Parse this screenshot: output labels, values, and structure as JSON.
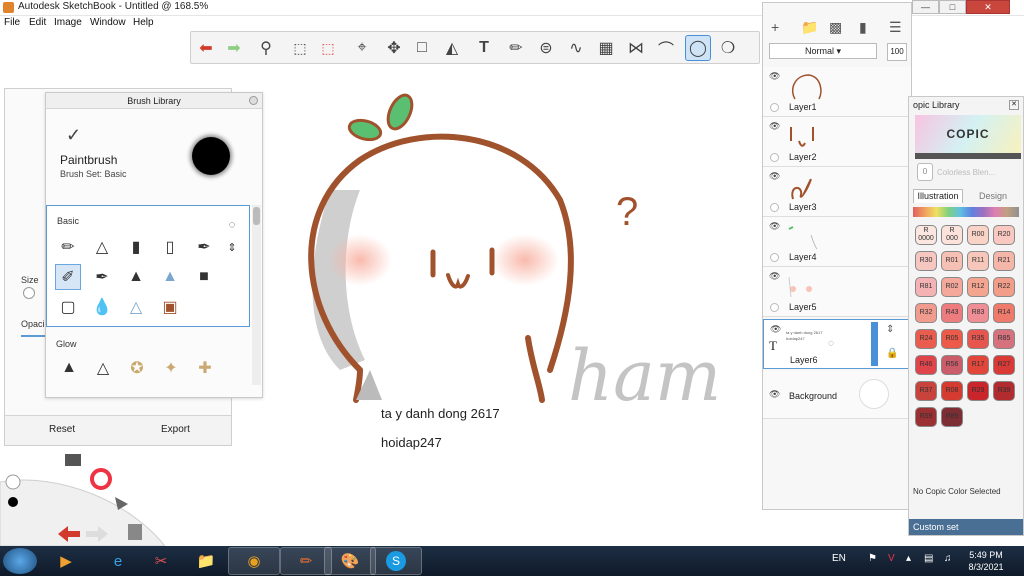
{
  "window": {
    "title": "Autodesk SketchBook - Untitled @ 168.5%"
  },
  "menu": {
    "items": [
      "File",
      "Edit",
      "Image",
      "Window",
      "Help"
    ]
  },
  "toolbar": {
    "tools": [
      "undo-icon",
      "redo-icon",
      "zoom-icon",
      "select-icon",
      "crop-icon",
      "move-icon",
      "distort-icon",
      "fill-icon",
      "text-icon",
      "ruler-icon",
      "ellipse-icon",
      "french-curve-icon",
      "perspective-icon",
      "symmetry-icon",
      "curve-icon",
      "circle-icon",
      "shape-icon"
    ],
    "active": "circle-icon"
  },
  "brush_properties": {
    "size_label": "Size",
    "opacity_label": "Opaci",
    "reset_label": "Reset",
    "export_label": "Export"
  },
  "brush_library": {
    "title": "Brush Library",
    "current_brush": "Paintbrush",
    "current_set": "Brush Set: Basic",
    "section_basic": "Basic",
    "section_glow": "Glow",
    "selected_brush": "paintbrush"
  },
  "canvas": {
    "caption1": "ta y danh dong 2617",
    "caption2": "hoidap247",
    "question_mark": "?",
    "handwriting": "ham"
  },
  "layers": {
    "blend_mode": "Normal",
    "opacity": "100",
    "items": [
      {
        "name": "Layer1"
      },
      {
        "name": "Layer2"
      },
      {
        "name": "Layer3"
      },
      {
        "name": "Layer4"
      },
      {
        "name": "Layer5"
      },
      {
        "name": "Layer6"
      },
      {
        "name": "Background"
      }
    ],
    "active_index": 5,
    "text_layer_preview": "ta y danh dong 2617 hoidap247"
  },
  "copic": {
    "title": "opic Library",
    "logo": "COPIC",
    "current_value": "0",
    "current_name": "Colorless Blen...",
    "tab_illustration": "Illustration",
    "tab_design": "Design",
    "status": "No Copic Color Selected",
    "custom_set": "Custom set",
    "chips": [
      {
        "code": "R\n0000",
        "color": "#fbe7e0"
      },
      {
        "code": "R\n000",
        "color": "#fbe2da"
      },
      {
        "code": "R00",
        "color": "#f9d3c6"
      },
      {
        "code": "R20",
        "color": "#f9c8c0"
      },
      {
        "code": "R30",
        "color": "#f6c6c0"
      },
      {
        "code": "R01",
        "color": "#f7c0b4"
      },
      {
        "code": "R11",
        "color": "#f7c7bb"
      },
      {
        "code": "R21",
        "color": "#f5b6aa"
      },
      {
        "code": "R81",
        "color": "#f5b2b4"
      },
      {
        "code": "R02",
        "color": "#f4a89b"
      },
      {
        "code": "R12",
        "color": "#f4a58f"
      },
      {
        "code": "R22",
        "color": "#f29d8a"
      },
      {
        "code": "R32",
        "color": "#f19b8f"
      },
      {
        "code": "R43",
        "color": "#ec7c7e"
      },
      {
        "code": "R83",
        "color": "#ef8f95"
      },
      {
        "code": "R14",
        "color": "#ee7a6b"
      },
      {
        "code": "R24",
        "color": "#ea5c4e"
      },
      {
        "code": "R05",
        "color": "#ec5a4a"
      },
      {
        "code": "R35",
        "color": "#e6564f"
      },
      {
        "code": "R85",
        "color": "#d5727e"
      },
      {
        "code": "R46",
        "color": "#e0444b"
      },
      {
        "code": "R56",
        "color": "#cb5c6a"
      },
      {
        "code": "R17",
        "color": "#e2463a"
      },
      {
        "code": "R27",
        "color": "#d93a36"
      },
      {
        "code": "R37",
        "color": "#c8433b"
      },
      {
        "code": "R08",
        "color": "#d63b31"
      },
      {
        "code": "R29",
        "color": "#c9252b"
      },
      {
        "code": "R39",
        "color": "#b12b2f"
      },
      {
        "code": "R59",
        "color": "#9a3032"
      },
      {
        "code": "R89",
        "color": "#7d2e34"
      }
    ]
  },
  "taskbar": {
    "language": "EN",
    "time": "5:49 PM",
    "date": "8/3/2021"
  }
}
